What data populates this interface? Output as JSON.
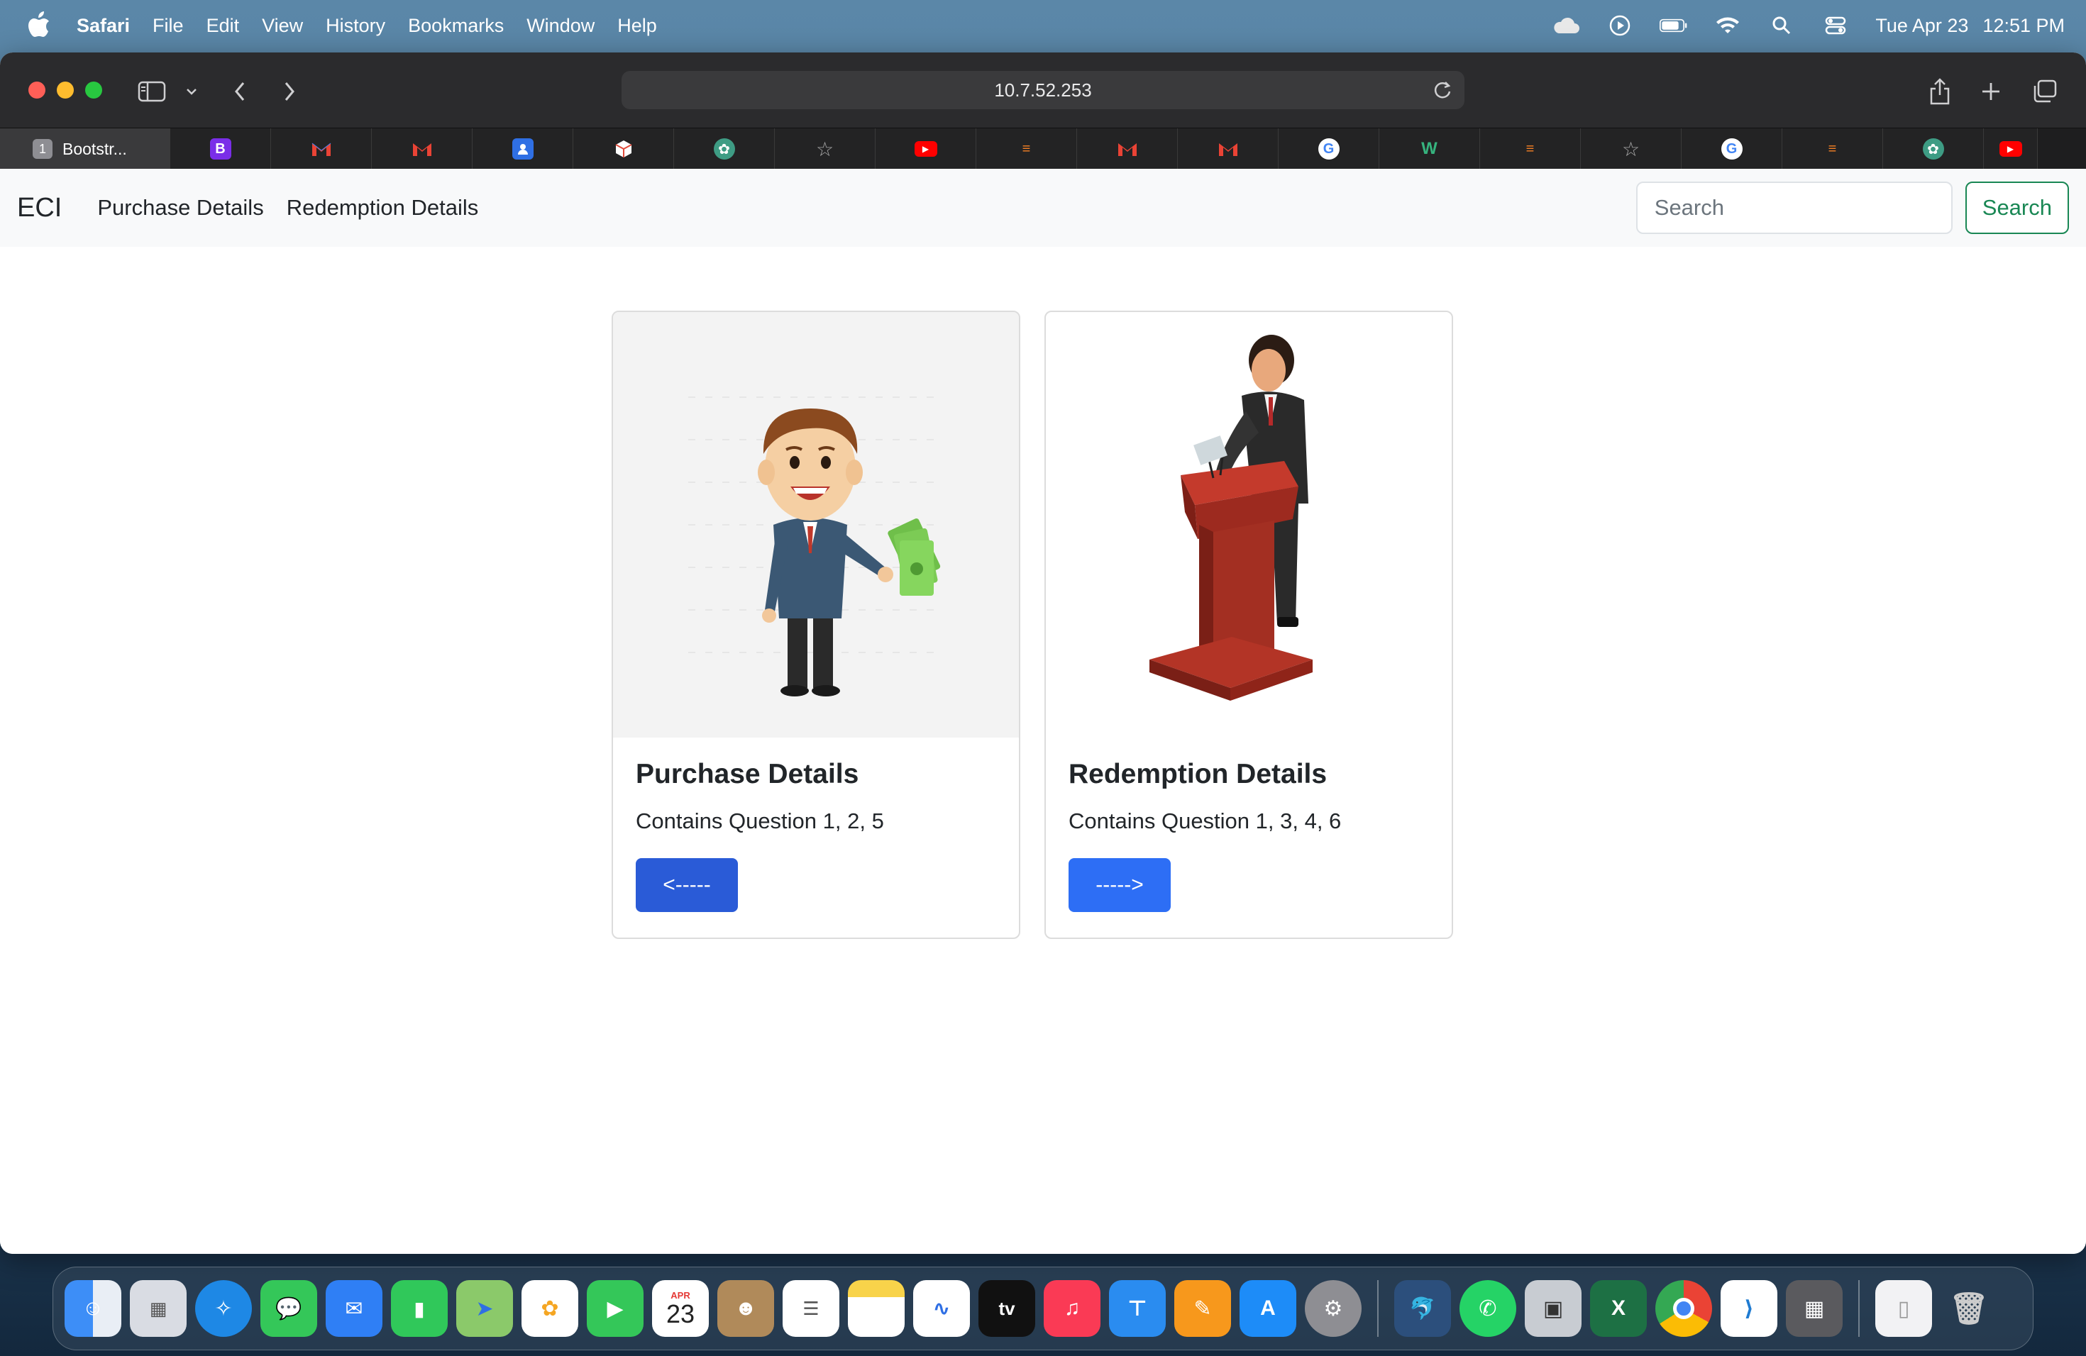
{
  "menubar": {
    "app_name": "Safari",
    "menus": [
      "File",
      "Edit",
      "View",
      "History",
      "Bookmarks",
      "Window",
      "Help"
    ],
    "date": "Tue Apr 23",
    "time": "12:51 PM"
  },
  "browser": {
    "url": "10.7.52.253",
    "active_tab": {
      "number": "1",
      "title": "Bootstr..."
    },
    "tab_icons": [
      "bootstrap-icon",
      "gmail-icon",
      "gmail-icon",
      "contacts-icon",
      "cube-icon",
      "chatgpt-icon",
      "star-icon",
      "youtube-icon",
      "stackoverflow-icon",
      "gmail-icon",
      "gmail-icon",
      "google-icon",
      "wikipedia-icon",
      "stackoverflow-icon",
      "star-icon",
      "google-icon",
      "stackoverflow-icon",
      "chatgpt-icon",
      "youtube-icon"
    ]
  },
  "navbar": {
    "brand": "ECI",
    "links": [
      "Purchase Details",
      "Redemption Details"
    ],
    "search_placeholder": "Search",
    "search_button": "Search"
  },
  "cards": [
    {
      "title": "Purchase Details",
      "text": "Contains Question 1, 2, 5",
      "button": "<-----"
    },
    {
      "title": "Redemption Details",
      "text": "Contains Question 1, 3, 4, 6",
      "button": "----->"
    }
  ],
  "dock": {
    "calendar_month": "APR",
    "calendar_day": "23",
    "tv_label": "tv"
  },
  "colors": {
    "primary": "#2d6ef5",
    "success": "#198754",
    "navbar_bg": "#f8f9fa"
  }
}
